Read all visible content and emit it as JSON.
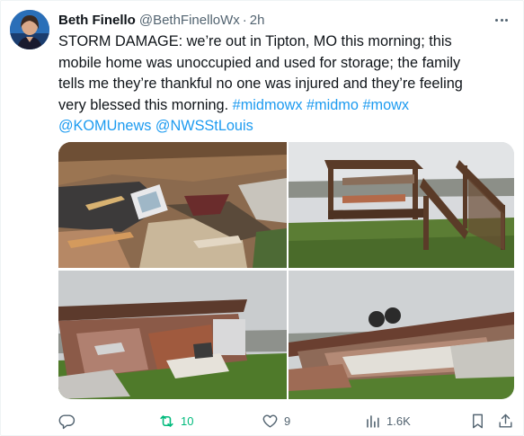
{
  "post": {
    "author": {
      "display_name": "Beth Finello",
      "handle": "@BethFinelloWx",
      "separator": "·",
      "time": "2h"
    },
    "text": {
      "line1": "STORM DAMAGE: we’re out in Tipton, MO this morning; this",
      "line2": "mobile home was unoccupied and used for storage; the family",
      "line3": "tells me they’re thankful no one was injured and they’re feeling",
      "line4_text": "very blessed this morning. ",
      "hashtag1": "#midmowx",
      "hashtag2": "#midmo",
      "hashtag3": "#mowx",
      "mention1": "@KOMUnews",
      "mention2": "@NWSStLouis"
    },
    "media_count": 4
  },
  "actions": {
    "reply_icon": "reply-icon",
    "retweet_count": "10",
    "like_count": "9",
    "views_count": "1.6K",
    "bookmark_icon": "bookmark-icon",
    "share_icon": "share-icon"
  },
  "colors": {
    "link": "#1d9bf0",
    "retweet_active": "#00ba7c",
    "secondary_text": "#536471",
    "primary_text": "#0f1419"
  }
}
